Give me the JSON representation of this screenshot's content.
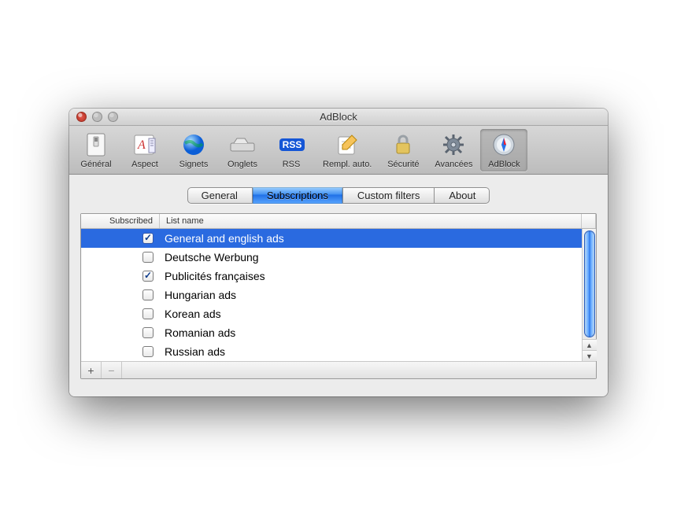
{
  "window": {
    "title": "AdBlock"
  },
  "toolbar": {
    "items": [
      {
        "label": "Général"
      },
      {
        "label": "Aspect"
      },
      {
        "label": "Signets"
      },
      {
        "label": "Onglets"
      },
      {
        "label": "RSS"
      },
      {
        "label": "Rempl. auto."
      },
      {
        "label": "Sécurité"
      },
      {
        "label": "Avancées"
      },
      {
        "label": "AdBlock"
      }
    ],
    "rss_badge": "RSS",
    "selected_index": 8
  },
  "tabs": {
    "items": [
      {
        "label": "General"
      },
      {
        "label": "Subscriptions"
      },
      {
        "label": "Custom filters"
      },
      {
        "label": "About"
      }
    ],
    "active_index": 1
  },
  "table": {
    "columns": {
      "subscribed": "Subscribed",
      "listname": "List name"
    },
    "rows": [
      {
        "subscribed": true,
        "name": "General and english ads",
        "selected": true
      },
      {
        "subscribed": false,
        "name": "Deutsche Werbung"
      },
      {
        "subscribed": true,
        "name": "Publicités françaises"
      },
      {
        "subscribed": false,
        "name": "Hungarian ads"
      },
      {
        "subscribed": false,
        "name": "Korean ads"
      },
      {
        "subscribed": false,
        "name": "Romanian ads"
      },
      {
        "subscribed": false,
        "name": "Russian ads"
      }
    ]
  },
  "footer": {
    "add": "+",
    "remove": "−"
  }
}
